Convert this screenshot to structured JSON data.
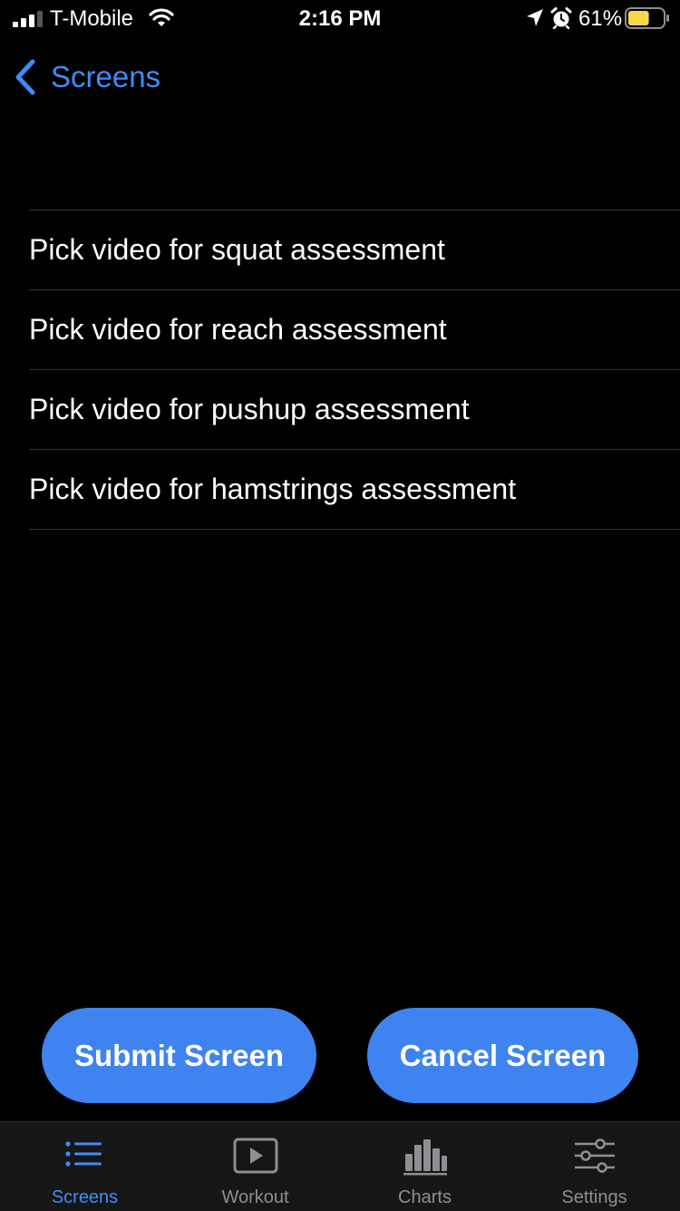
{
  "status_bar": {
    "carrier": "T-Mobile",
    "time": "2:16 PM",
    "battery_percent": "61%",
    "battery_level": 0.61,
    "icons": [
      "signal-icon",
      "wifi-icon",
      "location-icon",
      "alarm-icon",
      "battery-icon"
    ]
  },
  "nav": {
    "back_label": "Screens"
  },
  "list": {
    "items": [
      "Pick video for squat assessment",
      "Pick video for reach assessment",
      "Pick video for pushup assessment",
      "Pick video for hamstrings assessment"
    ]
  },
  "actions": {
    "submit_label": "Submit Screen",
    "cancel_label": "Cancel Screen"
  },
  "tabs": [
    {
      "label": "Screens",
      "icon": "list-icon",
      "active": true
    },
    {
      "label": "Workout",
      "icon": "play-icon",
      "active": false
    },
    {
      "label": "Charts",
      "icon": "bar-chart-icon",
      "active": false
    },
    {
      "label": "Settings",
      "icon": "sliders-icon",
      "active": false
    }
  ],
  "colors": {
    "background": "#000000",
    "accent": "#3f8cf7",
    "button": "#3f83f0",
    "tab_inactive": "#8e8e93",
    "battery_fill": "#f7d74a"
  }
}
